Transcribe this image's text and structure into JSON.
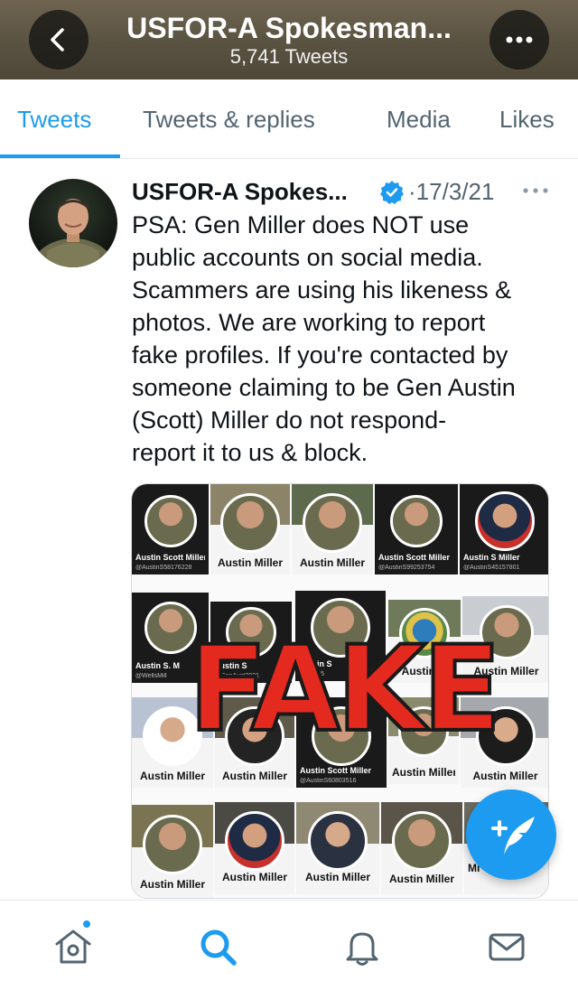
{
  "header": {
    "title": "USFOR-A Spokesman...",
    "subtitle": "5,741 Tweets"
  },
  "tabs": [
    {
      "label": "Tweets",
      "active": true
    },
    {
      "label": "Tweets & replies",
      "active": false
    },
    {
      "label": "Media",
      "active": false
    },
    {
      "label": "Likes",
      "active": false
    }
  ],
  "tweet": {
    "author_name": "USFOR-A Spokes...",
    "verified": true,
    "separator": "·",
    "date": "17/3/21",
    "text": "PSA: Gen Miller does NOT use\npublic accounts on social media.\nScammers are using his likeness &\nphotos. We are working to report\nfake profiles. If you're contacted by\nsomeone claiming to be Gen Austin\n(Scott) Miller do not respond-\nreport it to us & block."
  },
  "media": {
    "stamp_text": "FAKE",
    "cards": [
      {
        "name": "Austin Scott Miller",
        "handle": "@AustinS58176228"
      },
      {
        "name": "Austin Miller"
      },
      {
        "name": "Austin Miller"
      },
      {
        "name": "Austin Scott Miller",
        "handle": "@AustinS99253754"
      },
      {
        "name": "Austin S Miller",
        "handle": "@AustinS45157801"
      },
      {
        "name": "Austin S. M",
        "handle": "@WellsMill"
      },
      {
        "name": "Austin S",
        "handle": "@GenAust2021"
      },
      {
        "name": "Austin S",
        "handle": "AustinS5"
      },
      {
        "name": "Austin M"
      },
      {
        "name": "Austin Miller"
      },
      {
        "name": "Austin Miller"
      },
      {
        "name": "Austin Miller"
      },
      {
        "name": "Austin Scott Miller",
        "handle": "@AustinS60803516"
      },
      {
        "name": "Austin Miller"
      },
      {
        "name": "Austin Miller"
      },
      {
        "name": "Austin Miller"
      },
      {
        "name": "Austin Miller"
      },
      {
        "name": "Austin Miller"
      },
      {
        "name": "Austin Miller"
      },
      {
        "name": "Mi"
      }
    ]
  },
  "colors": {
    "accent": "#1d9bf0",
    "stamp_red": "#e4291f",
    "header_bg": "#5a5241"
  },
  "icons": {
    "header_left": "chevron-left-icon",
    "header_right": "more-horizontal-icon",
    "tweet_more": "more-horizontal-icon",
    "verified": "verified-badge-icon",
    "fab": "compose-tweet-icon",
    "nav": [
      "home-icon",
      "search-icon",
      "notifications-bell-icon",
      "messages-envelope-icon"
    ]
  },
  "bottom_nav": {
    "active": "search",
    "home_has_new": true
  }
}
